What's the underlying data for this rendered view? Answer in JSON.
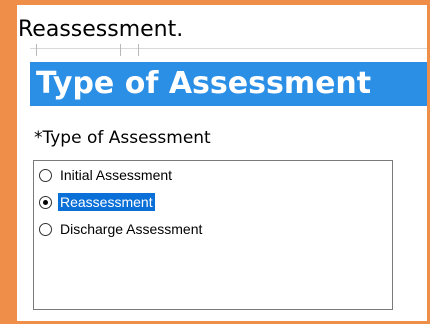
{
  "caption": "Reassessment.",
  "header": {
    "title": "Type of Assessment"
  },
  "field": {
    "label": "*Type of Assessment"
  },
  "options": [
    {
      "label": "Initial Assessment",
      "selected": false
    },
    {
      "label": "Reassessment",
      "selected": true
    },
    {
      "label": "Discharge Assessment",
      "selected": false
    }
  ],
  "colors": {
    "frame": "#ee8e48",
    "header_bg": "#2b8fe5",
    "selection_bg": "#0a6fd6"
  }
}
